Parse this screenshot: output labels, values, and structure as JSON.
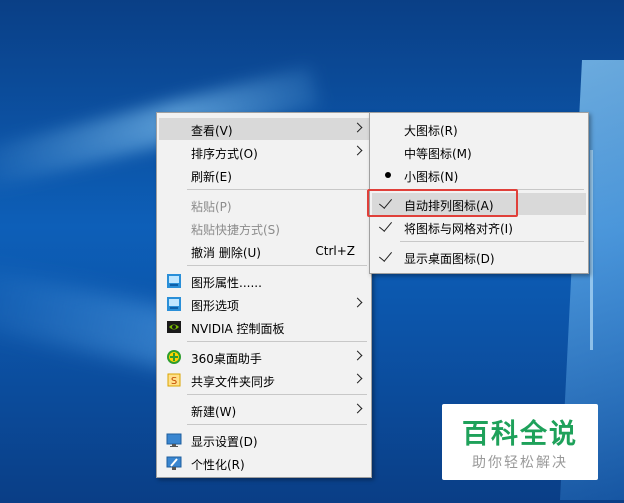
{
  "context_menu": {
    "items": [
      {
        "label": "查看(V)"
      },
      {
        "label": "排序方式(O)"
      },
      {
        "label": "刷新(E)"
      },
      {
        "label": "粘贴(P)"
      },
      {
        "label": "粘贴快捷方式(S)"
      },
      {
        "label": "撤消 删除(U)",
        "accel": "Ctrl+Z"
      },
      {
        "label": "图形属性......",
        "icon": "intel-graphics-icon"
      },
      {
        "label": "图形选项",
        "icon": "intel-graphics-icon"
      },
      {
        "label": "NVIDIA 控制面板",
        "icon": "nvidia-icon"
      },
      {
        "label": "360桌面助手",
        "icon": "360-icon"
      },
      {
        "label": "共享文件夹同步",
        "icon": "sync-folder-icon"
      },
      {
        "label": "新建(W)"
      },
      {
        "label": "显示设置(D)",
        "icon": "display-icon"
      },
      {
        "label": "个性化(R)",
        "icon": "personalize-icon"
      }
    ]
  },
  "view_submenu": {
    "items": [
      {
        "label": "大图标(R)"
      },
      {
        "label": "中等图标(M)"
      },
      {
        "label": "小图标(N)",
        "state": "selected"
      },
      {
        "label": "自动排列图标(A)",
        "state": "checked"
      },
      {
        "label": "将图标与网格对齐(I)",
        "state": "checked"
      },
      {
        "label": "显示桌面图标(D)",
        "state": "checked"
      }
    ]
  },
  "watermark": {
    "title": "百科全说",
    "subtitle": "助你轻松解决"
  },
  "colors": {
    "highlight_border": "#e0403a",
    "watermark_green": "#1ea15a",
    "desktop_blue": "#0d5fb8"
  }
}
